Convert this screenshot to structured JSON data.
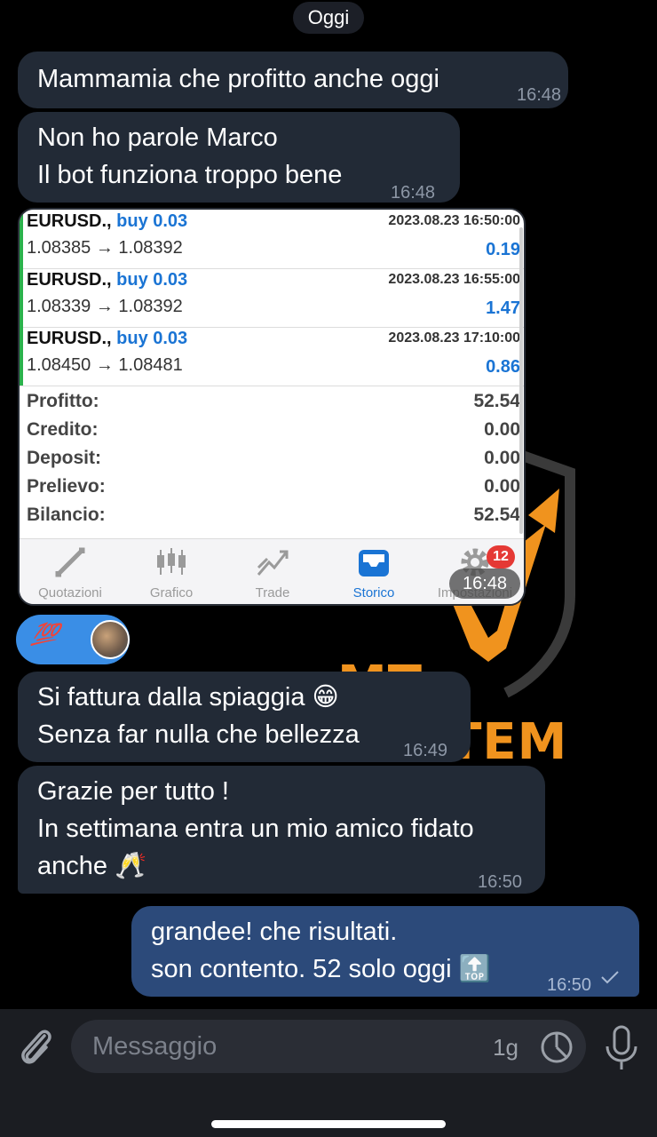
{
  "date_separator": "Oggi",
  "messages": [
    {
      "lines": [
        "Mammamia che profitto anche oggi"
      ],
      "time": "16:48"
    },
    {
      "lines": [
        "Non ho parole Marco",
        "Il bot funziona troppo bene"
      ],
      "time": "16:48"
    },
    {
      "lines": [
        "Si fattura dalla spiaggia 😁",
        "Senza far nulla che bellezza"
      ],
      "time": "16:49"
    },
    {
      "lines": [
        "Grazie per tutto !",
        "In settimana entra un mio amico fidato",
        "anche 🥂"
      ],
      "time": "16:50"
    }
  ],
  "outgoing": {
    "lines": [
      "grandee! che risultati.",
      "son contento. 52 solo oggi 🔝"
    ],
    "time": "16:50",
    "status_icon": "check-icon"
  },
  "reaction": {
    "emoji": "💯"
  },
  "screenshot": {
    "trades": [
      {
        "symbol": "EURUSD.,",
        "side": "buy 0.03",
        "datetime": "2023.08.23 16:50:00",
        "prices": "1.08385 → 1.08392",
        "profit": "0.19"
      },
      {
        "symbol": "EURUSD.,",
        "side": "buy 0.03",
        "datetime": "2023.08.23 16:55:00",
        "prices": "1.08339 → 1.08392",
        "profit": "1.47"
      },
      {
        "symbol": "EURUSD.,",
        "side": "buy 0.03",
        "datetime": "2023.08.23 17:10:00",
        "prices": "1.08450 → 1.08481",
        "profit": "0.86"
      }
    ],
    "summary": [
      {
        "label": "Profitto:",
        "value": "52.54"
      },
      {
        "label": "Credito:",
        "value": "0.00"
      },
      {
        "label": "Deposit:",
        "value": "0.00"
      },
      {
        "label": "Prelievo:",
        "value": "0.00"
      },
      {
        "label": "Bilancio:",
        "value": "52.54"
      }
    ],
    "tabs": [
      {
        "label": "Quotazioni",
        "icon": "quotes-arrows-icon"
      },
      {
        "label": "Grafico",
        "icon": "candlestick-icon"
      },
      {
        "label": "Trade",
        "icon": "trend-icon"
      },
      {
        "label": "Storico",
        "icon": "inbox-icon",
        "active": true
      },
      {
        "label": "Impostazioni",
        "icon": "gear-icon"
      }
    ],
    "badge": "12",
    "timestamp": "16:48"
  },
  "background_logo_text": "MT SYSTEM",
  "composer": {
    "placeholder": "Messaggio",
    "timer_label": "1g"
  },
  "colors": {
    "incoming_bubble": "#222a36",
    "outgoing_bubble": "#2c4a7a",
    "accent_orange": "#f0931e",
    "buy_blue": "#1a74d4"
  }
}
